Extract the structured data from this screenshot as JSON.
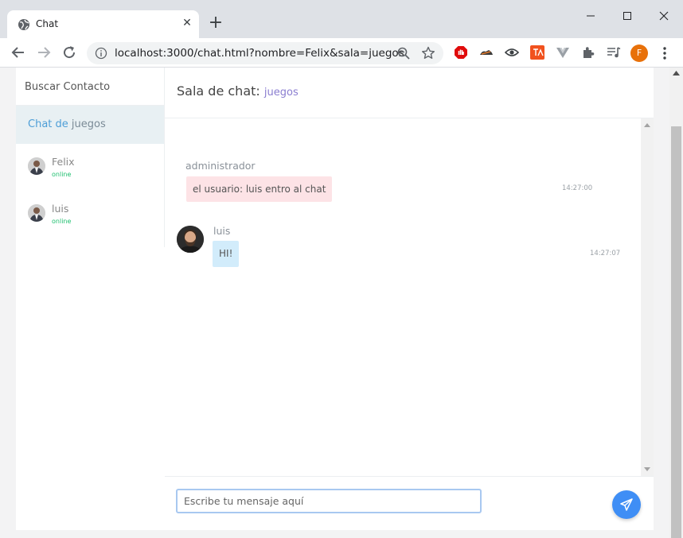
{
  "browser": {
    "tab_title": "Chat",
    "url": "localhost:3000/chat.html?nombre=Felix&sala=juegos",
    "profile_initial": "F"
  },
  "sidebar": {
    "search_label": "Buscar Contacto",
    "room_prefix": "Chat de ",
    "room_name": "juegos",
    "users": [
      {
        "name": "Felix",
        "status": "online"
      },
      {
        "name": "luis",
        "status": "online"
      }
    ]
  },
  "chat": {
    "header_label": "Sala de chat:",
    "room": "juegos",
    "messages": [
      {
        "sender": "administrador",
        "text": "el usuario: luis entro al chat",
        "time": "14:27:00"
      },
      {
        "sender": "luis",
        "text": "HI!",
        "time": "14:27:07"
      }
    ],
    "input_placeholder": "Escribe tu mensaje aquí"
  },
  "colors": {
    "accent": "#3f8ef5",
    "online": "#20c070",
    "admin_bubble": "#fde3e6",
    "user_bubble": "#d2ecfb"
  }
}
